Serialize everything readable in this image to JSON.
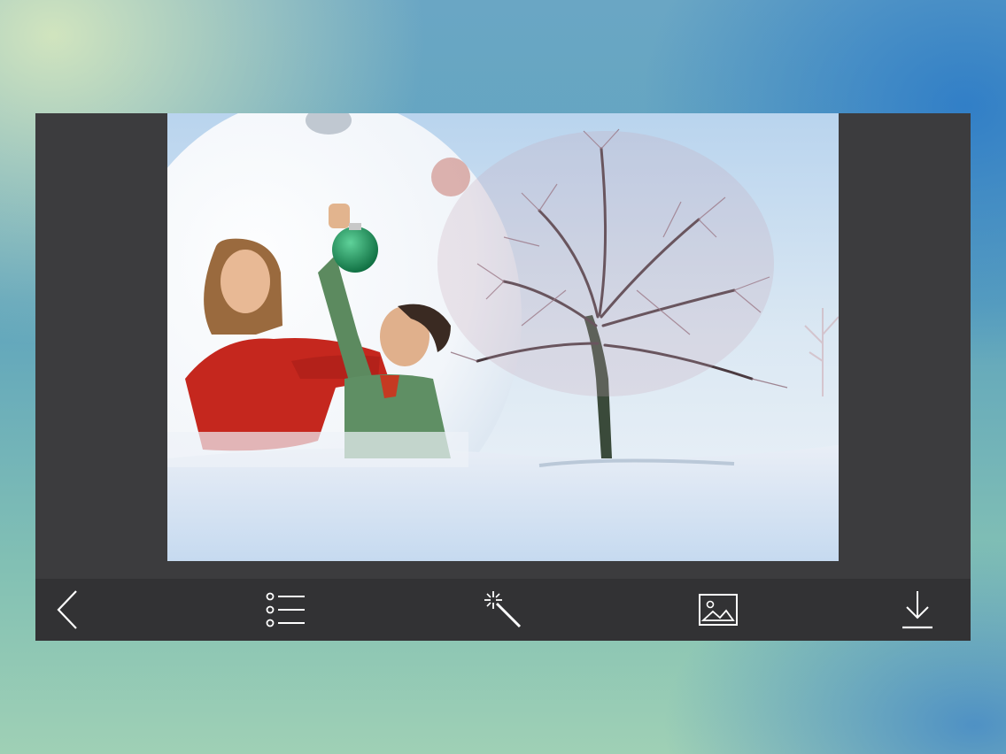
{
  "app": {
    "canvas_photo": "couple-winter-tree-frame-photo"
  },
  "toolbar": {
    "items": [
      {
        "icon": "back-chevron-icon"
      },
      {
        "icon": "list-icon"
      },
      {
        "icon": "magic-wand-icon"
      },
      {
        "icon": "image-gallery-icon"
      },
      {
        "icon": "download-icon"
      }
    ]
  },
  "colors": {
    "device_bg": "#3c3c3e",
    "toolbar_bg": "#323234",
    "icon_color": "#ffffff"
  }
}
